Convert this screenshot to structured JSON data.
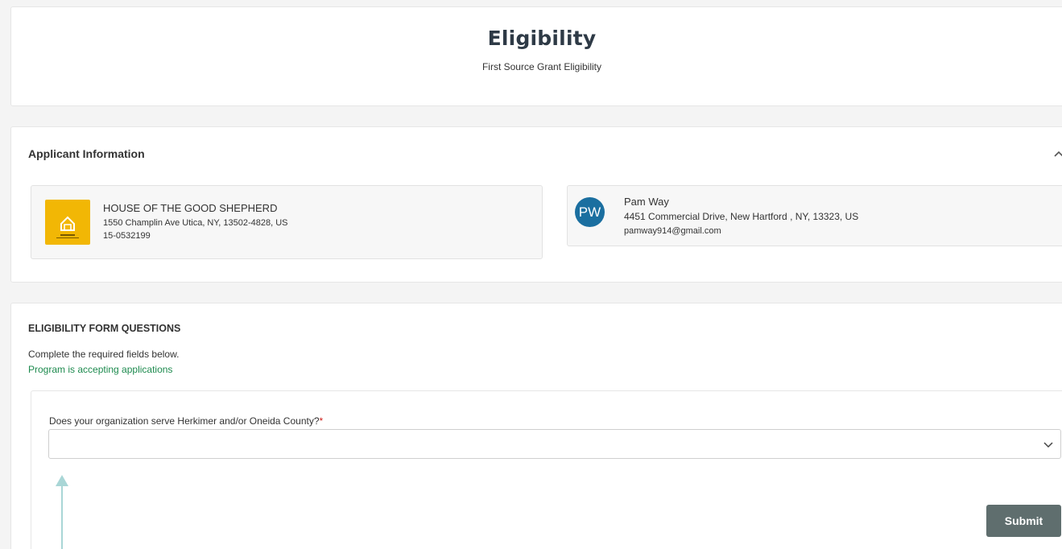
{
  "header": {
    "title": "Eligibility",
    "subtitle": "First Source Grant Eligibility"
  },
  "applicant": {
    "section_title": "Applicant Information",
    "organization": {
      "logo_icon": "house-logo-icon",
      "logo_color": "#f2b705",
      "name": "HOUSE OF THE GOOD SHEPHERD",
      "address": "1550 Champlin Ave Utica, NY, 13502-4828, US",
      "ein": "15-0532199"
    },
    "contact": {
      "initials": "PW",
      "avatar_color": "#1b6fa0",
      "name": "Pam Way",
      "address": "4451 Commercial Drive, New Hartford , NY, 13323, US",
      "email": "pamway914@gmail.com"
    }
  },
  "form": {
    "heading": "ELIGIBILITY FORM QUESTIONS",
    "instructions": "Complete the required fields below.",
    "status": "Program is accepting applications",
    "status_color": "#1d8a4e",
    "question": {
      "label": "Does your organization serve Herkimer and/or Oneida County?",
      "required_mark": "*",
      "selected_value": ""
    },
    "submit_label": "Submit"
  }
}
